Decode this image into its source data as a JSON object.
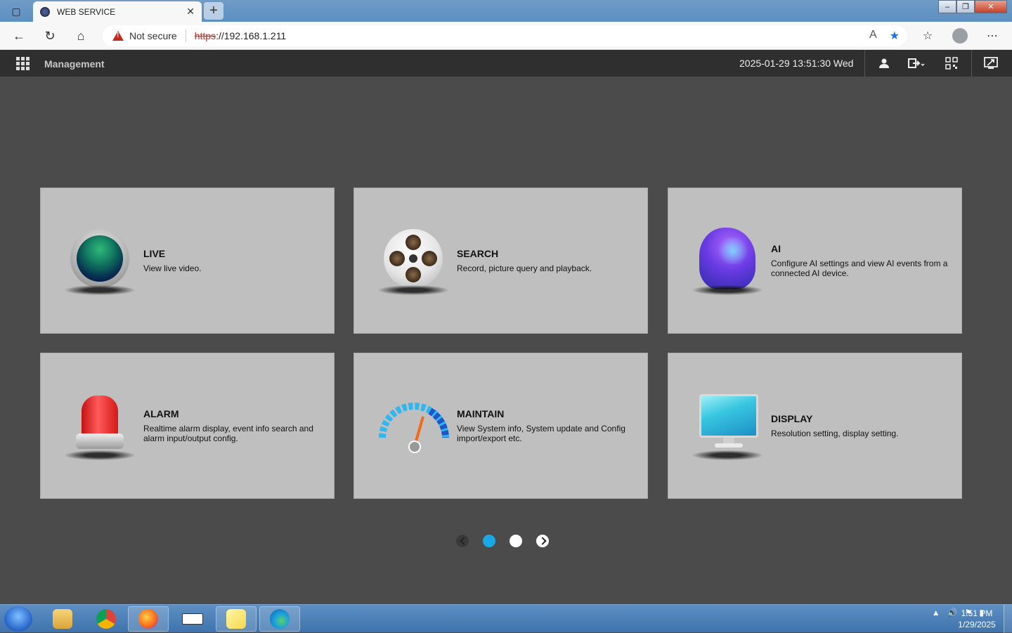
{
  "browser": {
    "tab_title": "WEB SERVICE",
    "not_secure_label": "Not secure",
    "url_scheme": "https",
    "url_rest": "://192.168.1.211"
  },
  "app": {
    "title": "Management",
    "datetime": "2025-01-29 13:51:30 Wed"
  },
  "cards": [
    {
      "title": "LIVE",
      "desc": "View live video.",
      "icon": "live-view-icon"
    },
    {
      "title": "SEARCH",
      "desc": "Record, picture query and playback.",
      "icon": "film-reel-icon"
    },
    {
      "title": "AI",
      "desc": "Configure AI settings and view AI events from a connected AI device.",
      "icon": "ai-head-icon"
    },
    {
      "title": "ALARM",
      "desc": "Realtime alarm display, event info search and alarm input/output config.",
      "icon": "alarm-siren-icon"
    },
    {
      "title": "MAINTAIN",
      "desc": "View System info, System update and Config import/export etc.",
      "icon": "gauge-icon"
    },
    {
      "title": "DISPLAY",
      "desc": "Resolution setting, display setting.",
      "icon": "monitor-icon"
    }
  ],
  "pager": {
    "current_page": 1,
    "total_pages": 2
  },
  "taskbar": {
    "time": "1:51 PM",
    "date": "1/29/2025"
  },
  "colors": {
    "accent": "#19a7e6",
    "header_bg": "#2f2f2f",
    "card_bg": "#bfbfbf"
  }
}
